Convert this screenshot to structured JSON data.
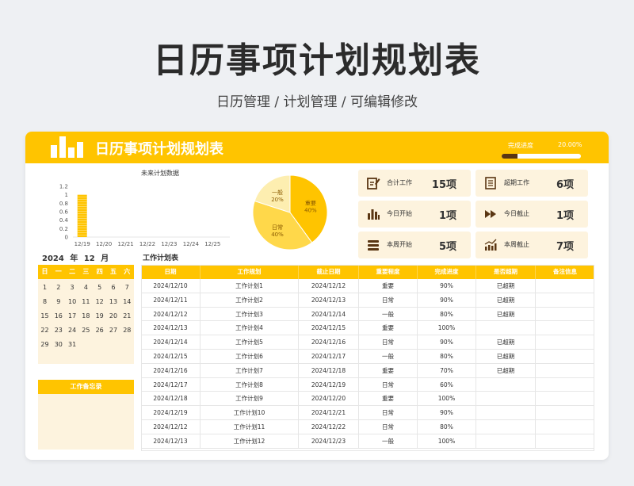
{
  "hero": {
    "title": "日历事项计划规划表",
    "subtitle": "日历管理 / 计划管理 / 可编辑修改"
  },
  "topbar": {
    "title": "日历事项计划规划表",
    "progress_label": "完成进度",
    "progress_value": "20.00%",
    "progress_fraction": 0.2
  },
  "colors": {
    "accent": "#ffc400",
    "dark": "#5a3613",
    "light": "#fdf3de",
    "pie_light": "#fdeeb0",
    "pie_mid": "#ffd84a"
  },
  "chart_data": {
    "type": "bar",
    "title": "未来计划数据",
    "categories": [
      "12/19",
      "12/20",
      "12/21",
      "12/22",
      "12/23",
      "12/24",
      "12/25"
    ],
    "values": [
      1,
      0,
      0,
      0,
      0,
      0,
      0
    ],
    "ylim": [
      0,
      1.2
    ],
    "yticks": [
      "1.2",
      "1",
      "0.8",
      "0.6",
      "0.4",
      "0.2",
      "0"
    ],
    "ytick_values": [
      1.2,
      1,
      0.8,
      0.6,
      0.4,
      0.2,
      0
    ]
  },
  "pie": {
    "slices": [
      {
        "name": "重要",
        "pct": "40%",
        "value": 40,
        "color": "#ffc400"
      },
      {
        "name": "日常",
        "pct": "40%",
        "value": 40,
        "color": "#ffd84a"
      },
      {
        "name": "一般",
        "pct": "20%",
        "value": 20,
        "color": "#fdeeb0"
      }
    ]
  },
  "stats": [
    {
      "label": "合计工作",
      "value": "15项",
      "icon": "edit-document-icon"
    },
    {
      "label": "超期工作",
      "value": "6项",
      "icon": "list-document-icon"
    },
    {
      "label": "今日开始",
      "value": "1项",
      "icon": "bar-chart-icon"
    },
    {
      "label": "今日截止",
      "value": "1项",
      "icon": "fast-forward-icon"
    },
    {
      "label": "本周开始",
      "value": "5项",
      "icon": "stack-icon"
    },
    {
      "label": "本周截止",
      "value": "7项",
      "icon": "trend-chart-icon"
    }
  ],
  "calendar": {
    "year": "2024",
    "year_unit": "年",
    "month": "12",
    "month_unit": "月",
    "weekdays": [
      "日",
      "一",
      "二",
      "三",
      "四",
      "五",
      "六"
    ],
    "weeks": [
      [
        "1",
        "2",
        "3",
        "4",
        "5",
        "6",
        "7"
      ],
      [
        "8",
        "9",
        "10",
        "11",
        "12",
        "13",
        "14"
      ],
      [
        "15",
        "16",
        "17",
        "18",
        "19",
        "20",
        "21"
      ],
      [
        "22",
        "23",
        "24",
        "25",
        "26",
        "27",
        "28"
      ],
      [
        "29",
        "30",
        "31",
        "",
        "",
        "",
        ""
      ]
    ]
  },
  "memo": {
    "title": "工作备忘录"
  },
  "table": {
    "title": "工作计划表",
    "columns": [
      "日期",
      "工作规划",
      "截止日期",
      "重要程度",
      "完成进度",
      "是否超期",
      "备注信息"
    ],
    "rows": [
      [
        "2024/12/10",
        "工作计划1",
        "2024/12/12",
        "重要",
        "90%",
        "已超期",
        ""
      ],
      [
        "2024/12/11",
        "工作计划2",
        "2024/12/13",
        "日常",
        "90%",
        "已超期",
        ""
      ],
      [
        "2024/12/12",
        "工作计划3",
        "2024/12/14",
        "一般",
        "80%",
        "已超期",
        ""
      ],
      [
        "2024/12/13",
        "工作计划4",
        "2024/12/15",
        "重要",
        "100%",
        "",
        ""
      ],
      [
        "2024/12/14",
        "工作计划5",
        "2024/12/16",
        "日常",
        "90%",
        "已超期",
        ""
      ],
      [
        "2024/12/15",
        "工作计划6",
        "2024/12/17",
        "一般",
        "80%",
        "已超期",
        ""
      ],
      [
        "2024/12/16",
        "工作计划7",
        "2024/12/18",
        "重要",
        "70%",
        "已超期",
        ""
      ],
      [
        "2024/12/17",
        "工作计划8",
        "2024/12/19",
        "日常",
        "60%",
        "",
        ""
      ],
      [
        "2024/12/18",
        "工作计划9",
        "2024/12/20",
        "重要",
        "100%",
        "",
        ""
      ],
      [
        "2024/12/19",
        "工作计划10",
        "2024/12/21",
        "日常",
        "90%",
        "",
        ""
      ],
      [
        "2024/12/12",
        "工作计划11",
        "2024/12/22",
        "日常",
        "80%",
        "",
        ""
      ],
      [
        "2024/12/13",
        "工作计划12",
        "2024/12/23",
        "一般",
        "100%",
        "",
        ""
      ]
    ]
  }
}
